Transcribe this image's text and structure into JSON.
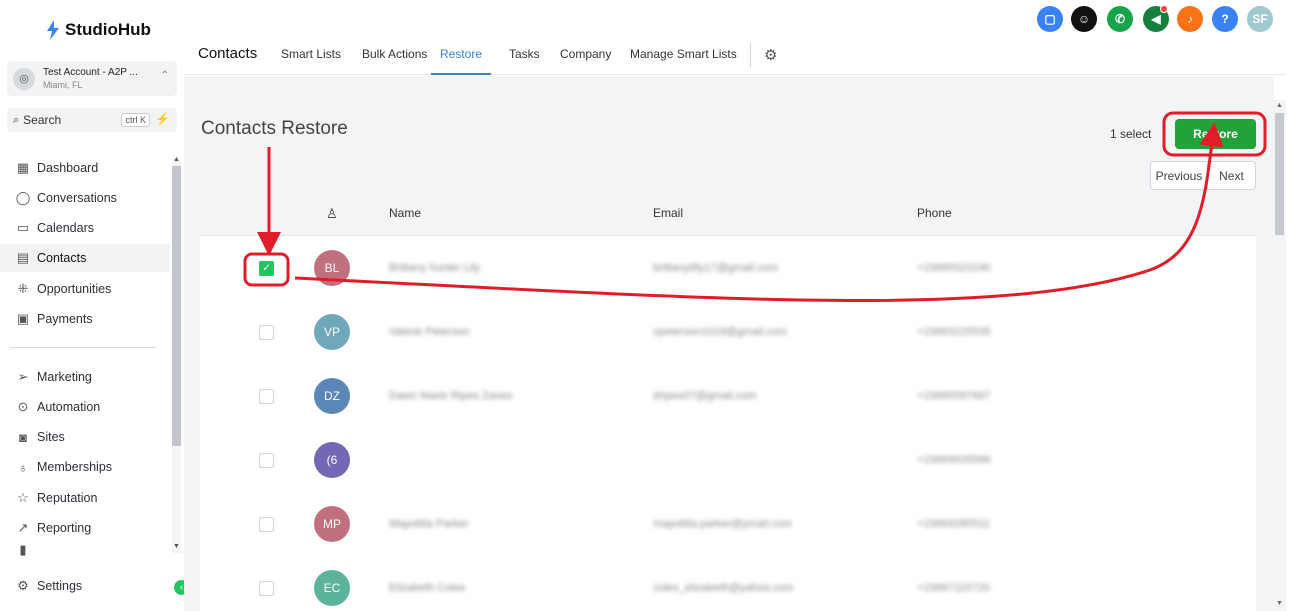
{
  "brand": {
    "name": "StudioHub"
  },
  "account": {
    "name": "Test Account - A2P ...",
    "location": "Miami, FL"
  },
  "search": {
    "label": "Search",
    "shortcut": "ctrl K"
  },
  "sidebar": {
    "items": [
      {
        "label": "Dashboard",
        "icon": "dashboard-icon"
      },
      {
        "label": "Conversations",
        "icon": "chat-icon"
      },
      {
        "label": "Calendars",
        "icon": "calendar-icon"
      },
      {
        "label": "Contacts",
        "icon": "contacts-icon",
        "active": true
      },
      {
        "label": "Opportunities",
        "icon": "opportunities-icon"
      },
      {
        "label": "Payments",
        "icon": "payments-icon"
      },
      {
        "label": "Marketing",
        "icon": "send-icon"
      },
      {
        "label": "Automation",
        "icon": "automation-icon"
      },
      {
        "label": "Sites",
        "icon": "sites-icon"
      },
      {
        "label": "Memberships",
        "icon": "memberships-icon"
      },
      {
        "label": "Reputation",
        "icon": "star-icon"
      },
      {
        "label": "Reporting",
        "icon": "reporting-icon"
      }
    ],
    "settings": "Settings"
  },
  "topnav": {
    "title": "Contacts",
    "tabs": [
      "Smart Lists",
      "Bulk Actions",
      "Restore",
      "Tasks",
      "Company",
      "Manage Smart Lists"
    ],
    "active_tab": "Restore"
  },
  "header": {
    "user_initials": "SF"
  },
  "page": {
    "title": "Contacts Restore",
    "selected_count": "1 select",
    "restore_label": "Restore",
    "previous_label": "Previous",
    "next_label": "Next"
  },
  "table": {
    "headers": {
      "name": "Name",
      "email": "Email",
      "phone": "Phone"
    },
    "rows": [
      {
        "initials": "BL",
        "color": "#c0707d",
        "checked": true
      },
      {
        "initials": "VP",
        "color": "#6fa8b8",
        "checked": false
      },
      {
        "initials": "DZ",
        "color": "#5a86b8",
        "checked": false
      },
      {
        "initials": "(6",
        "color": "#7467b5",
        "checked": false
      },
      {
        "initials": "MP",
        "color": "#c0707d",
        "checked": false
      },
      {
        "initials": "EC",
        "color": "#5ab39a",
        "checked": false
      }
    ]
  },
  "colors": {
    "accent": "#3b82c4",
    "restore_green": "#22a33a",
    "annotation_red": "#e11d2a"
  }
}
